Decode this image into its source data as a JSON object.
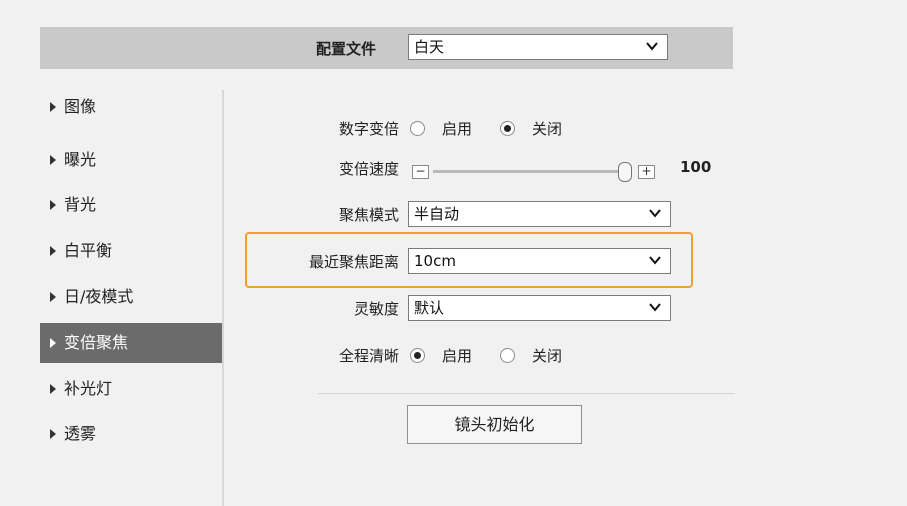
{
  "header": {
    "profile_label": "配置文件",
    "profile_value": "白天"
  },
  "sidebar": {
    "items": [
      {
        "label": "图像"
      },
      {
        "label": "曝光"
      },
      {
        "label": "背光"
      },
      {
        "label": "白平衡"
      },
      {
        "label": "日/夜模式"
      },
      {
        "label": "变倍聚焦",
        "active": true
      },
      {
        "label": "补光灯"
      },
      {
        "label": "透雾"
      }
    ]
  },
  "form": {
    "digital_zoom": {
      "label": "数字变倍",
      "option_on": "启用",
      "option_off": "关闭",
      "selected": "关闭"
    },
    "zoom_speed": {
      "label": "变倍速度",
      "minus": "−",
      "plus": "+",
      "value": "100"
    },
    "focus_mode": {
      "label": "聚焦模式",
      "value": "半自动"
    },
    "min_focus_distance": {
      "label": "最近聚焦距离",
      "value": "10cm"
    },
    "sensitivity": {
      "label": "灵敏度",
      "value": "默认"
    },
    "full_range_clear": {
      "label": "全程清晰",
      "option_on": "启用",
      "option_off": "关闭",
      "selected": "启用"
    },
    "lens_init_button": "镜头初始化"
  },
  "colors": {
    "highlight": "#f0a030",
    "active_nav_bg": "#6b6b6b",
    "topbar_bg": "#c9c9c9"
  }
}
